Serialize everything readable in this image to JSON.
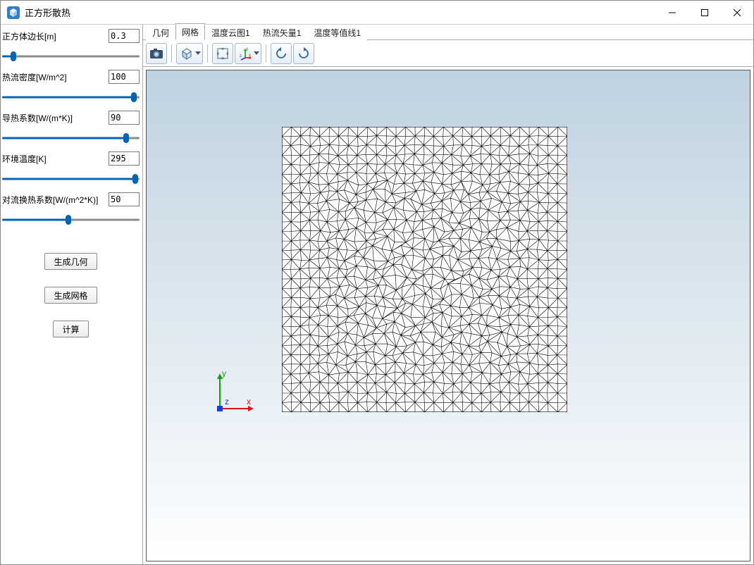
{
  "window": {
    "title": "正方形散热"
  },
  "sidebar": {
    "params": [
      {
        "label": "正方体边长[m]",
        "value": "0.3",
        "slider": 8
      },
      {
        "label": "热流密度[W/m^2]",
        "value": "100",
        "slider": 96
      },
      {
        "label": "导热系数[W/(m*K)]",
        "value": "90",
        "slider": 90
      },
      {
        "label": "环境温度[K]",
        "value": "295",
        "slider": 97
      },
      {
        "label": "对流换热系数[W/(m^2*K)]",
        "value": "50",
        "slider": 48
      }
    ],
    "buttons": {
      "gen_geometry": "生成几何",
      "gen_mesh": "生成网格",
      "compute": "计算"
    }
  },
  "tabs": [
    {
      "label": "几何",
      "selected": false
    },
    {
      "label": "网格",
      "selected": true
    },
    {
      "label": "温度云图1",
      "selected": false
    },
    {
      "label": "热流矢量1",
      "selected": false
    },
    {
      "label": "温度等值线1",
      "selected": false
    }
  ],
  "toolbar_icons": {
    "screenshot": "screenshot-icon",
    "view_cube": "cube-view-icon",
    "zoom_extents": "zoom-extents-icon",
    "axes": "xyz-axes-icon",
    "rotate_ccw": "rotate-ccw-icon",
    "rotate_cw": "rotate-cw-icon"
  },
  "triad": {
    "x": "x",
    "y": "y",
    "z": "z",
    "colors": {
      "x": "#e11212",
      "y": "#12a012",
      "z": "#1040e0"
    }
  }
}
